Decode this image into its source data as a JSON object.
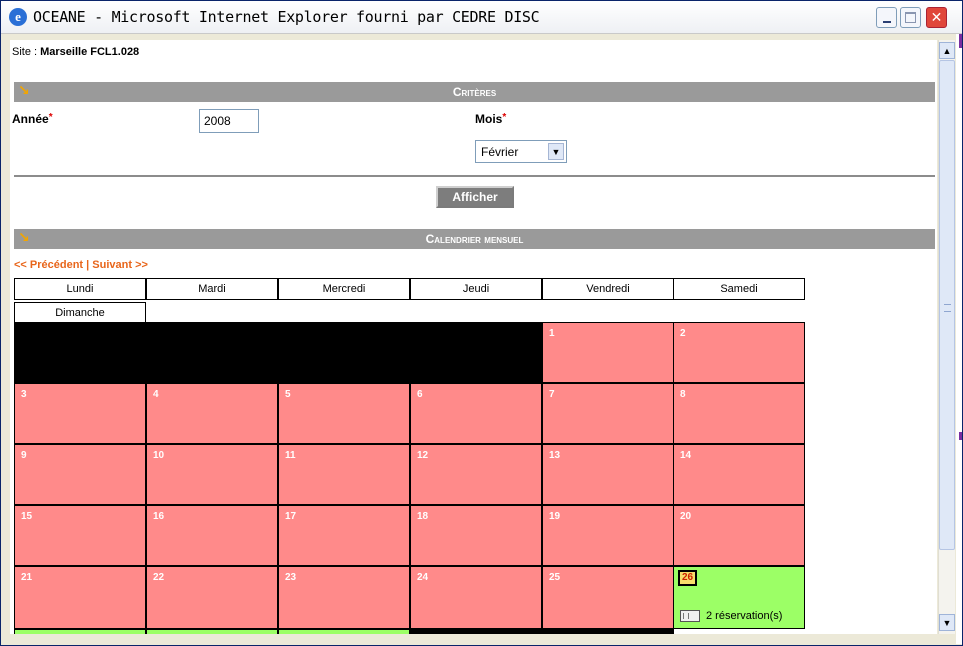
{
  "window": {
    "title": "OCEANE - Microsoft Internet Explorer fourni par CEDRE DISC",
    "controls": {
      "minimize": "minimize-icon",
      "maximize": "maximize-icon",
      "close": "close-icon"
    }
  },
  "site": {
    "label": "Site : ",
    "value": "Marseille FCL1.028"
  },
  "criteria": {
    "title": "Critères",
    "year_label": "Année",
    "year_value": "2008",
    "month_label": "Mois",
    "month_value": "Février",
    "required_mark": "*",
    "show_button": "Afficher"
  },
  "calendar": {
    "title": "Calendrier mensuel",
    "nav_prev": "<< Précédent",
    "nav_sep": "|",
    "nav_next": "Suivant >>",
    "days": [
      "Lundi",
      "Mardi",
      "Mercredi",
      "Jeudi",
      "Vendredi",
      "Samedi",
      "Dimanche"
    ],
    "dates": [
      "1",
      "2",
      "3",
      "4",
      "5",
      "6",
      "7",
      "8",
      "9",
      "10",
      "11",
      "12",
      "13",
      "14",
      "15",
      "16",
      "17",
      "18",
      "19",
      "20",
      "21",
      "22",
      "23",
      "24",
      "25",
      "26"
    ],
    "highlight_date": "26",
    "reservations_text": "2 réservation(s)"
  },
  "colors": {
    "section_bar": "#9a9a9a",
    "cell_pink": "#ff8a8a",
    "cell_green": "#9cff66",
    "nav_link": "#e8651a",
    "accent_arrow": "#f2a500"
  }
}
